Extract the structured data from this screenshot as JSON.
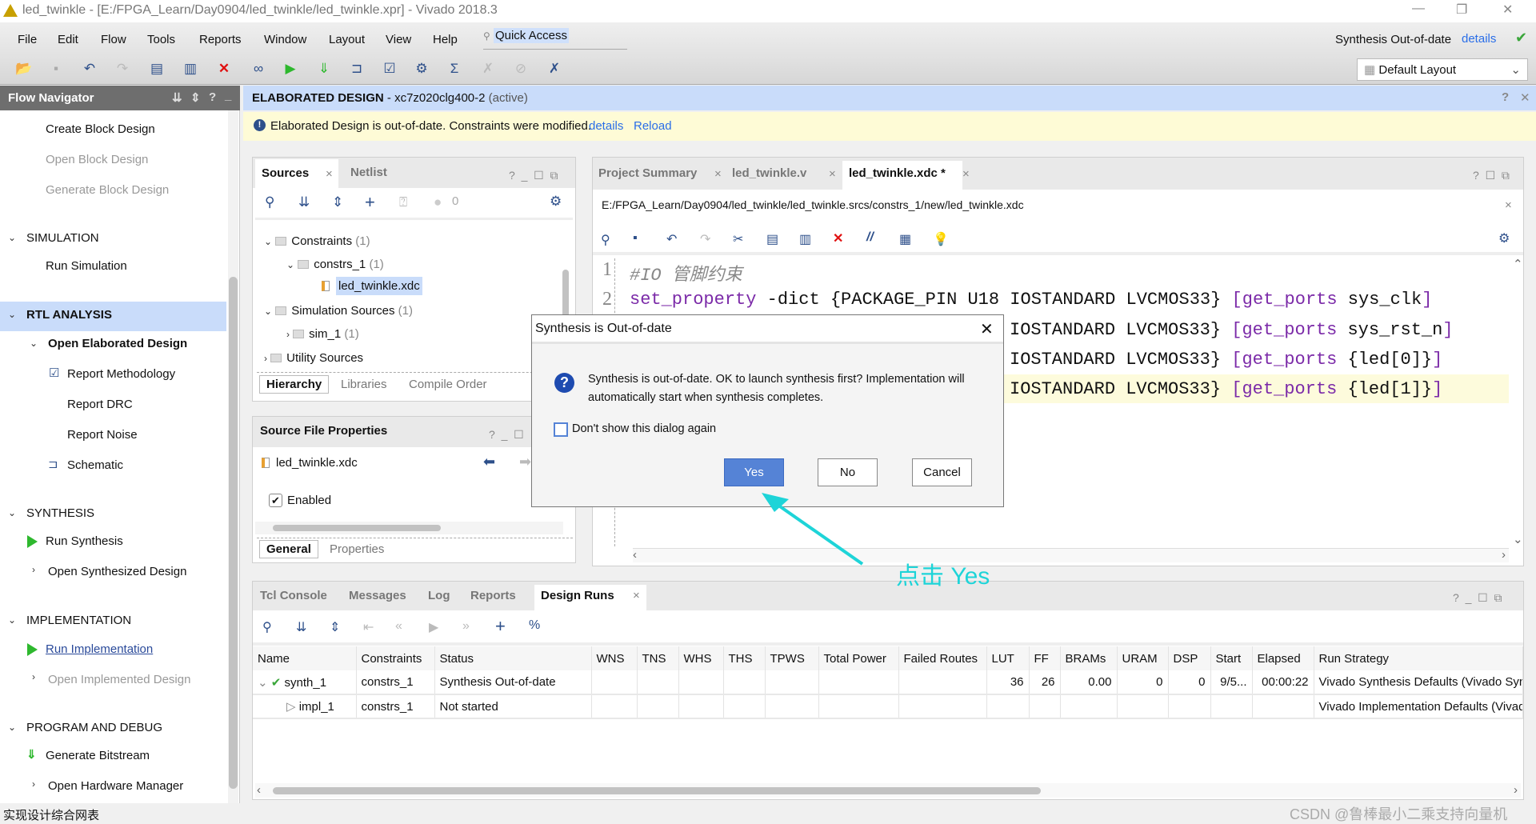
{
  "window": {
    "title": "led_twinkle - [E:/FPGA_Learn/Day0904/led_twinkle/led_twinkle.xpr] - Vivado 2018.3"
  },
  "menu": {
    "items": [
      "File",
      "Edit",
      "Flow",
      "Tools",
      "Reports",
      "Window",
      "Layout",
      "View",
      "Help"
    ],
    "quick_access": "Quick Access"
  },
  "status_right": {
    "text": "Synthesis Out-of-date",
    "link": "details",
    "layout": "Default Layout"
  },
  "flow_nav": {
    "title": "Flow Navigator",
    "items": {
      "create_bd": "Create Block Design",
      "open_bd": "Open Block Design",
      "gen_bd": "Generate Block Design",
      "simulation": "SIMULATION",
      "run_sim": "Run Simulation",
      "rtl": "RTL ANALYSIS",
      "open_elab": "Open Elaborated Design",
      "report_meth": "Report Methodology",
      "report_drc": "Report DRC",
      "report_noise": "Report Noise",
      "schematic": "Schematic",
      "synthesis": "SYNTHESIS",
      "run_synth": "Run Synthesis",
      "open_synth": "Open Synthesized Design",
      "implementation": "IMPLEMENTATION",
      "run_impl": "Run Implementation",
      "open_impl": "Open Implemented Design",
      "program": "PROGRAM AND DEBUG",
      "gen_bit": "Generate Bitstream",
      "open_hw": "Open Hardware Manager"
    }
  },
  "context": {
    "title": "ELABORATED DESIGN",
    "part": "- xc7z020clg400-2",
    "state": "(active)"
  },
  "warning": {
    "text": "Elaborated Design is out-of-date. Constraints were modified.",
    "details": "details",
    "reload": "Reload"
  },
  "sources": {
    "tabs": [
      "Sources",
      "Netlist"
    ],
    "count": "0",
    "tree": [
      {
        "label": "Constraints",
        "count": "(1)"
      },
      {
        "label": "constrs_1",
        "count": "(1)"
      },
      {
        "label": "led_twinkle.xdc",
        "count": ""
      },
      {
        "label": "Simulation Sources",
        "count": "(1)"
      },
      {
        "label": "sim_1",
        "count": "(1)"
      },
      {
        "label": "Utility Sources",
        "count": ""
      }
    ],
    "bottom_tabs": [
      "Hierarchy",
      "Libraries",
      "Compile Order"
    ]
  },
  "props": {
    "title": "Source File Properties",
    "file": "led_twinkle.xdc",
    "enabled": "Enabled",
    "enabled_checked": true,
    "tabs": [
      "General",
      "Properties"
    ]
  },
  "editor": {
    "tabs": [
      "Project Summary",
      "led_twinkle.v",
      "led_twinkle.xdc *"
    ],
    "path": "E:/FPGA_Learn/Day0904/led_twinkle/led_twinkle.srcs/constrs_1/new/led_twinkle.xdc",
    "lines": [
      {
        "n": "1",
        "comment": "#IO 管脚约束"
      },
      {
        "n": "2",
        "kw": "set_property",
        "a": " -dict {PACKAGE_PIN U18 IOSTANDARD LVCMOS33} ",
        "b": "[get_ports",
        "c": " sys_clk",
        "d": "]"
      },
      {
        "n": "3",
        "a": "IOSTANDARD LVCMOS33} ",
        "b": "[get_ports",
        "c": " sys_rst_n",
        "d": "]"
      },
      {
        "n": "4",
        "a": "IOSTANDARD LVCMOS33} ",
        "b": "[get_ports",
        "c": " {led[0]}",
        "d": "]"
      },
      {
        "n": "5",
        "a": "IOSTANDARD LVCMOS33} ",
        "b": "[get_ports",
        "c": " {led[1]}",
        "d": "]"
      }
    ]
  },
  "dialog": {
    "title": "Synthesis is Out-of-date",
    "message_1": "Synthesis is out-of-date. OK to launch synthesis first? Implementation will",
    "message_2": "automatically start when synthesis completes.",
    "checkbox": "Don't show this dialog again",
    "checkbox_checked": false,
    "yes": "Yes",
    "no": "No",
    "cancel": "Cancel"
  },
  "annotation": {
    "text": "点击 Yes",
    "color": "#1ed4d8"
  },
  "bottom": {
    "tabs": [
      "Tcl Console",
      "Messages",
      "Log",
      "Reports",
      "Design Runs"
    ],
    "columns": [
      "Name",
      "Constraints",
      "Status",
      "WNS",
      "TNS",
      "WHS",
      "THS",
      "TPWS",
      "Total Power",
      "Failed Routes",
      "LUT",
      "FF",
      "BRAMs",
      "URAM",
      "DSP",
      "Start",
      "Elapsed",
      "Run Strategy"
    ],
    "rows": [
      [
        "synth_1",
        "constrs_1",
        "Synthesis Out-of-date",
        "",
        "",
        "",
        "",
        "",
        "",
        "",
        "36",
        "26",
        "0.00",
        "0",
        "0",
        "9/5...",
        "00:00:22",
        "Vivado Synthesis Defaults (Vivado Synth"
      ],
      [
        "impl_1",
        "constrs_1",
        "Not started",
        "",
        "",
        "",
        "",
        "",
        "",
        "",
        "",
        "",
        "",
        "",
        "",
        "",
        "",
        "Vivado Implementation Defaults (Vivado"
      ]
    ]
  },
  "statusbar": {
    "text": "实现设计综合网表",
    "watermark": "CSDN @鲁棒最小二乘支持向量机"
  }
}
